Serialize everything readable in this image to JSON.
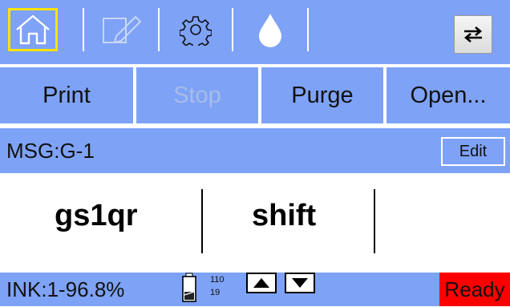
{
  "toolbar": {
    "buttons": [
      {
        "icon": "home-icon",
        "active": true
      },
      {
        "icon": "pencil-icon",
        "disabled": true
      },
      {
        "icon": "gear-icon"
      },
      {
        "icon": "ink-drop-icon"
      }
    ],
    "swap_icon": "swap-arrows-icon"
  },
  "commands": {
    "print": "Print",
    "stop": "Stop",
    "purge": "Purge",
    "open": "Open..."
  },
  "message": {
    "label": "MSG:G-1",
    "edit": "Edit"
  },
  "preview": {
    "segments": [
      "gs1qr",
      "shift"
    ]
  },
  "status": {
    "ink": "INK:1-96.8%",
    "count_top": "110",
    "count_bottom": "19",
    "ready": "Ready"
  },
  "colors": {
    "accent": "#7ea2f6",
    "active_border": "#ffe300",
    "ready": "#ff0000"
  }
}
